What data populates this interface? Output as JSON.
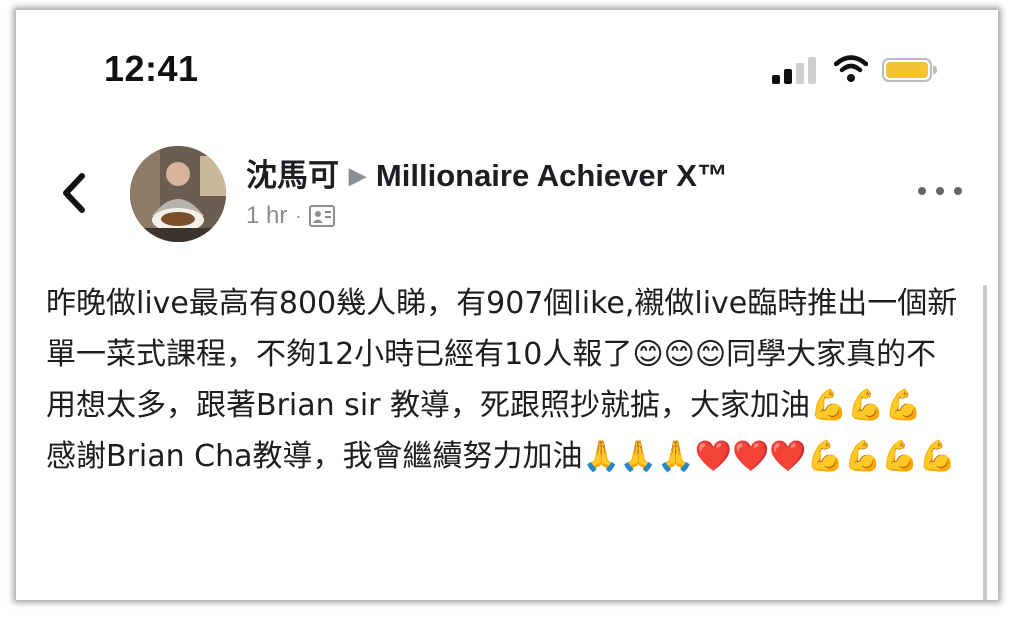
{
  "status_bar": {
    "time": "12:41",
    "battery_color": "#f4c233"
  },
  "header": {
    "back_icon": "chevron-left-icon",
    "author_name": "沈馬可",
    "group_name": "Millionaire Achiever X™",
    "timestamp": "1 hr",
    "separator": "·",
    "audience_icon": "group-audience-icon",
    "more_icon": "more-horizontal-icon"
  },
  "post": {
    "paragraph_1": "昨晚做live最高有800幾人睇，有907個like,襯做live臨時推出一個新單一菜式課程，不夠12小時已經有10人報了😊😊😊同學大家真的不用想太多，跟著Brian sir 教導，死跟照抄就掂，大家加油💪💪💪",
    "paragraph_2": "感謝Brian Cha教導，我會繼續努力加油🙏🙏🙏❤️❤️❤️💪💪💪💪"
  },
  "colors": {
    "text": "#1c1e21",
    "secondary": "#8a8d91"
  }
}
